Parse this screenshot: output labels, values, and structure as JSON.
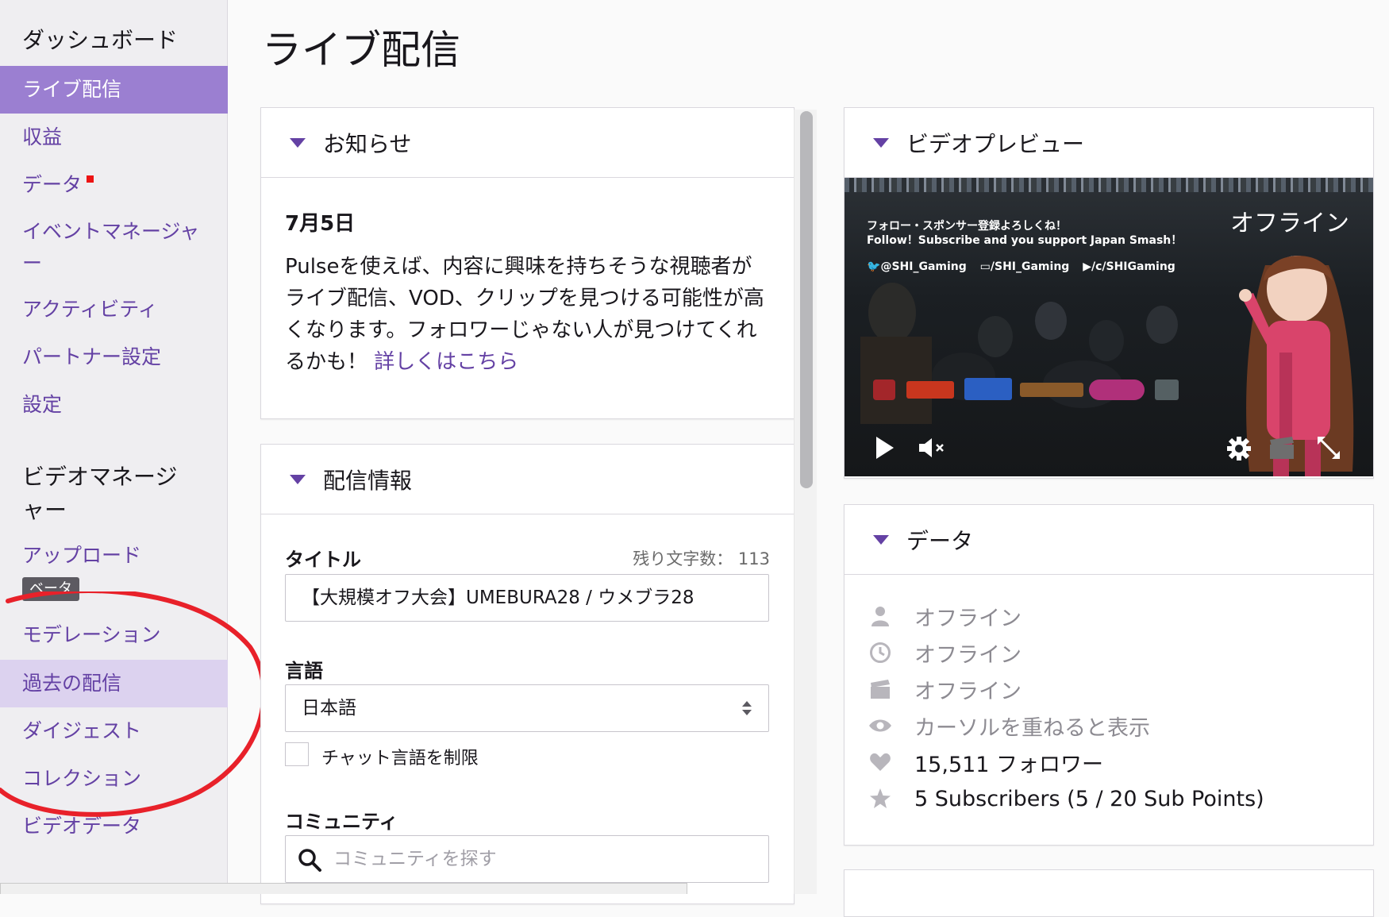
{
  "sidebar": {
    "dashboard_heading": "ダッシュボード",
    "dashboard_items": [
      {
        "label": "ライブ配信",
        "state": "active"
      },
      {
        "label": "収益"
      },
      {
        "label": "データ",
        "badge_dot": true
      },
      {
        "label": "イベントマネージャー"
      },
      {
        "label": "アクティビティ"
      },
      {
        "label": "パートナー設定"
      },
      {
        "label": "設定"
      }
    ],
    "video_manager_heading": "ビデオマネージャー",
    "video_items": [
      {
        "label": "アップロード",
        "badge": "ベータ"
      },
      {
        "label": "モデレーション"
      },
      {
        "label": "過去の配信",
        "state": "hover"
      },
      {
        "label": "ダイジェスト"
      },
      {
        "label": "コレクション"
      },
      {
        "label": "ビデオデータ"
      }
    ]
  },
  "page_title": "ライブ配信",
  "news": {
    "header": "お知らせ",
    "date": "7月5日",
    "body": "Pulseを使えば、内容に興味を持ちそうな視聴者がライブ配信、VOD、クリップを見つける可能性が高くなります。フォロワーじゃない人が見つけてくれるかも！",
    "link": "詳しくはこちら"
  },
  "stream_info": {
    "header": "配信情報",
    "title_label": "タイトル",
    "chars_left": "残り文字数： 113",
    "title_value": "【大規模オフ大会】UMEBURA28 / ウメブラ28",
    "language_label": "言語",
    "language_value": "日本語",
    "chat_restrict_label": "チャット言語を制限",
    "community_label": "コミュニティ",
    "community_placeholder": "コミュニティを探す"
  },
  "video_preview": {
    "header": "ビデオプレビュー",
    "offline_label": "オフライン",
    "overlay_line1": "フォロー・スポンサー登録よろしくね！",
    "overlay_line2": "Follow！Subscribe and you support Japan Smash！",
    "social": [
      "@SHI_Gaming",
      "/SHI_Gaming",
      "/c/SHIGaming"
    ]
  },
  "data_panel": {
    "header": "データ",
    "rows": [
      {
        "icon": "viewer-icon",
        "text": "オフライン",
        "muted": true
      },
      {
        "icon": "clock-icon",
        "text": "オフライン",
        "muted": true
      },
      {
        "icon": "clapper-icon",
        "text": "オフライン",
        "muted": true
      },
      {
        "icon": "eye-icon",
        "text": "カーソルを重ねると表示",
        "muted": true
      },
      {
        "icon": "heart-icon",
        "text": "15,511 フォロワー",
        "muted": false
      },
      {
        "icon": "star-icon",
        "text": "5 Subscribers (5 / 20 Sub Points)",
        "muted": false
      }
    ]
  },
  "colors": {
    "accent": "#6441a4",
    "active_bg": "#9b7fd1",
    "annotation": "#e8212a"
  }
}
